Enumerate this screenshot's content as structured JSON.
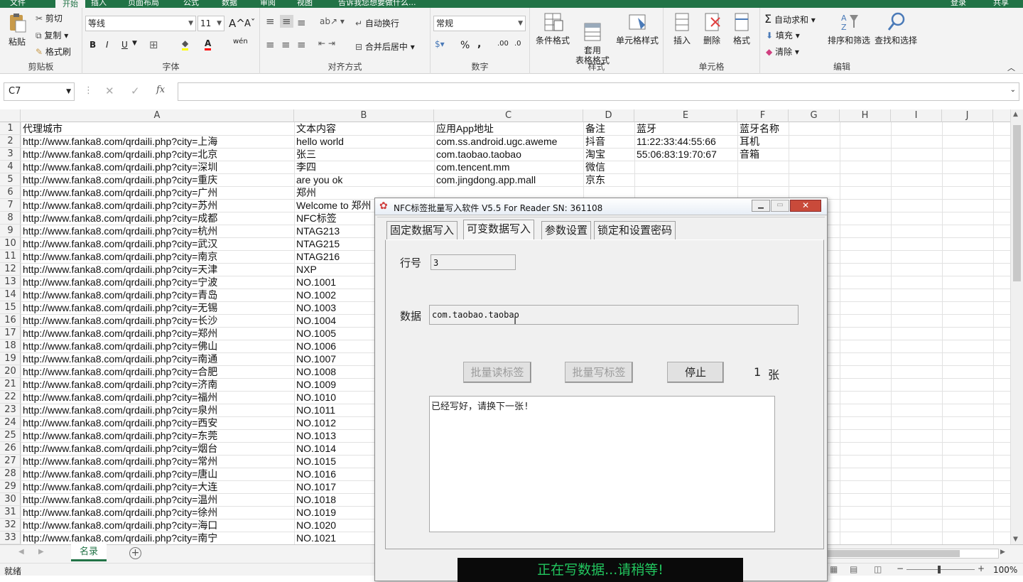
{
  "ribbon": {
    "tabs_top": [
      "文件",
      "开始",
      "插入",
      "页面布局",
      "公式",
      "数据",
      "审阅",
      "视图",
      "告诉我您想要做什么...",
      "登录",
      "共享"
    ],
    "clipboard": {
      "paste": "粘贴",
      "cut": "剪切",
      "copy": "复制",
      "format_painter": "格式刷",
      "label": "剪贴板"
    },
    "font": {
      "name": "等线",
      "size": "11",
      "bold": "B",
      "italic": "I",
      "underline": "U",
      "label": "字体",
      "grow": "A",
      "shrink": "A",
      "phonetic": "wén"
    },
    "align": {
      "wrap": "自动换行",
      "merge": "合并后居中",
      "label": "对齐方式"
    },
    "number": {
      "format": "常规",
      "percent": "%",
      "comma": ",",
      "label": "数字",
      "inc": ".00",
      "dec": ".0"
    },
    "styles": {
      "conditional": "条件格式",
      "table": "套用\n表格格式",
      "cell": "单元格样式",
      "label": "样式"
    },
    "cells": {
      "insert": "插入",
      "delete": "删除",
      "format": "格式",
      "label": "单元格"
    },
    "editing": {
      "autosum": "自动求和",
      "fill": "填充",
      "clear": "清除",
      "sort": "排序和筛选",
      "find": "查找和选择",
      "label": "编辑"
    }
  },
  "formula": {
    "namebox": "C7",
    "fx": "fx",
    "value": ""
  },
  "columns": [
    "A",
    "B",
    "C",
    "D",
    "E",
    "F",
    "G",
    "H",
    "I",
    "J"
  ],
  "rows": [
    [
      "代理城市",
      "文本内容",
      "应用App地址",
      "备注",
      "蓝牙",
      "蓝牙名称"
    ],
    [
      "http://www.fanka8.com/qrdaili.php?city=上海",
      "hello world",
      "com.ss.android.ugc.aweme",
      "抖音",
      "11:22:33:44:55:66",
      "耳机"
    ],
    [
      "http://www.fanka8.com/qrdaili.php?city=北京",
      "张三",
      "com.taobao.taobao",
      "淘宝",
      "55:06:83:19:70:67",
      "音箱"
    ],
    [
      "http://www.fanka8.com/qrdaili.php?city=深圳",
      "李四",
      "com.tencent.mm",
      "微信",
      "",
      ""
    ],
    [
      "http://www.fanka8.com/qrdaili.php?city=重庆",
      "are you ok",
      "com.jingdong.app.mall",
      "京东",
      "",
      ""
    ],
    [
      "http://www.fanka8.com/qrdaili.php?city=广州",
      "郑州",
      "",
      "",
      "",
      ""
    ],
    [
      "http://www.fanka8.com/qrdaili.php?city=苏州",
      "Welcome to 郑州",
      "",
      "",
      "",
      ""
    ],
    [
      "http://www.fanka8.com/qrdaili.php?city=成都",
      "NFC标签",
      "",
      "",
      "",
      ""
    ],
    [
      "http://www.fanka8.com/qrdaili.php?city=杭州",
      "NTAG213",
      "",
      "",
      "",
      ""
    ],
    [
      "http://www.fanka8.com/qrdaili.php?city=武汉",
      "NTAG215",
      "",
      "",
      "",
      ""
    ],
    [
      "http://www.fanka8.com/qrdaili.php?city=南京",
      "NTAG216",
      "",
      "",
      "",
      ""
    ],
    [
      "http://www.fanka8.com/qrdaili.php?city=天津",
      "NXP",
      "",
      "",
      "",
      ""
    ],
    [
      "http://www.fanka8.com/qrdaili.php?city=宁波",
      "NO.1001",
      "",
      "",
      "",
      ""
    ],
    [
      "http://www.fanka8.com/qrdaili.php?city=青岛",
      "NO.1002",
      "",
      "",
      "",
      ""
    ],
    [
      "http://www.fanka8.com/qrdaili.php?city=无锡",
      "NO.1003",
      "",
      "",
      "",
      ""
    ],
    [
      "http://www.fanka8.com/qrdaili.php?city=长沙",
      "NO.1004",
      "",
      "",
      "",
      ""
    ],
    [
      "http://www.fanka8.com/qrdaili.php?city=郑州",
      "NO.1005",
      "",
      "",
      "",
      ""
    ],
    [
      "http://www.fanka8.com/qrdaili.php?city=佛山",
      "NO.1006",
      "",
      "",
      "",
      ""
    ],
    [
      "http://www.fanka8.com/qrdaili.php?city=南通",
      "NO.1007",
      "",
      "",
      "",
      ""
    ],
    [
      "http://www.fanka8.com/qrdaili.php?city=合肥",
      "NO.1008",
      "",
      "",
      "",
      ""
    ],
    [
      "http://www.fanka8.com/qrdaili.php?city=济南",
      "NO.1009",
      "",
      "",
      "",
      ""
    ],
    [
      "http://www.fanka8.com/qrdaili.php?city=福州",
      "NO.1010",
      "",
      "",
      "",
      ""
    ],
    [
      "http://www.fanka8.com/qrdaili.php?city=泉州",
      "NO.1011",
      "",
      "",
      "",
      ""
    ],
    [
      "http://www.fanka8.com/qrdaili.php?city=西安",
      "NO.1012",
      "",
      "",
      "",
      ""
    ],
    [
      "http://www.fanka8.com/qrdaili.php?city=东莞",
      "NO.1013",
      "",
      "",
      "",
      ""
    ],
    [
      "http://www.fanka8.com/qrdaili.php?city=烟台",
      "NO.1014",
      "",
      "",
      "",
      ""
    ],
    [
      "http://www.fanka8.com/qrdaili.php?city=常州",
      "NO.1015",
      "",
      "",
      "",
      ""
    ],
    [
      "http://www.fanka8.com/qrdaili.php?city=唐山",
      "NO.1016",
      "",
      "",
      "",
      ""
    ],
    [
      "http://www.fanka8.com/qrdaili.php?city=大连",
      "NO.1017",
      "",
      "",
      "",
      ""
    ],
    [
      "http://www.fanka8.com/qrdaili.php?city=温州",
      "NO.1018",
      "",
      "",
      "",
      ""
    ],
    [
      "http://www.fanka8.com/qrdaili.php?city=徐州",
      "NO.1019",
      "",
      "",
      "",
      ""
    ],
    [
      "http://www.fanka8.com/qrdaili.php?city=海口",
      "NO.1020",
      "",
      "",
      "",
      ""
    ],
    [
      "http://www.fanka8.com/qrdaili.php?city=南宁",
      "NO.1021",
      "",
      "",
      "",
      ""
    ]
  ],
  "sheet_tab": "名录",
  "status": {
    "ready": "就绪",
    "zoom": "100%"
  },
  "dialog": {
    "title": "NFC标签批量写入软件 V5.5 For Reader  SN:  361108",
    "tabs": [
      "固定数据写入",
      "可变数据写入",
      "参数设置",
      "锁定和设置密码"
    ],
    "row_label": "行号",
    "row_value": "3",
    "data_label": "数据",
    "data_value": "com.taobao.taobao",
    "btn_read": "批量读标签",
    "btn_write": "批量写标签",
    "btn_stop": "停止",
    "count": "1",
    "count_unit": "张",
    "log": "已经写好，请换下一张!",
    "status": "正在写数据...请稍等!"
  },
  "colors": {
    "excel_green": "#217346",
    "status_green": "#22c55e",
    "status_bg": "#0a0a0a"
  }
}
